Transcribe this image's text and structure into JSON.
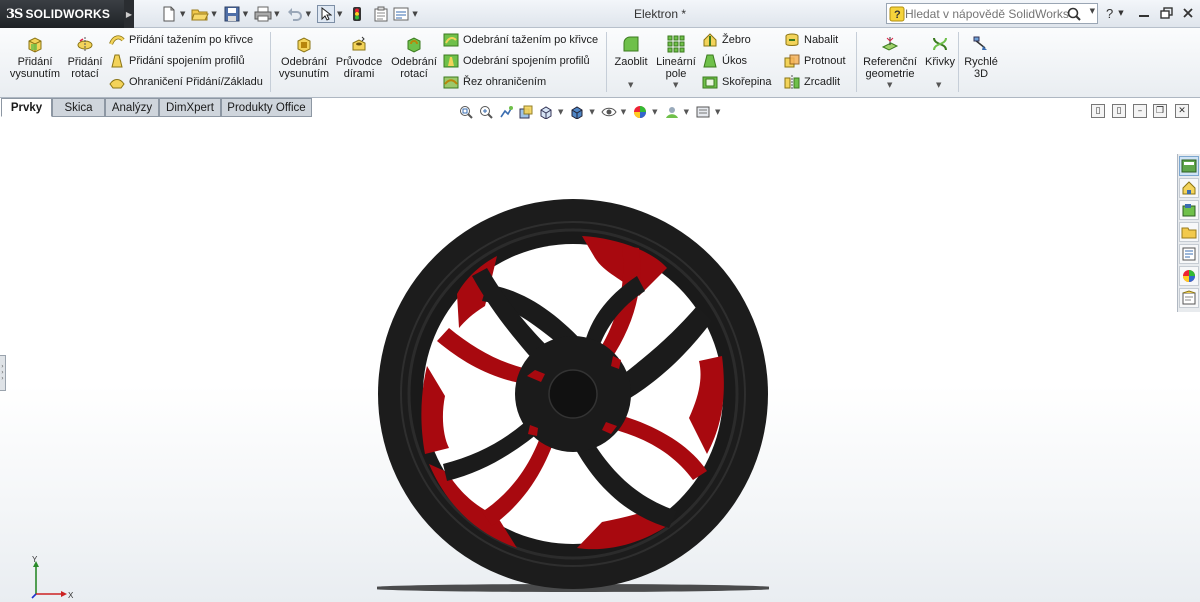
{
  "app": {
    "logo_ds": "3S",
    "logo_text": "SOLIDWORKS"
  },
  "title_bar": {
    "document_title": "Elektron *",
    "search_placeholder": "Hledat v nápovědě SolidWorks"
  },
  "quick_access": [
    "new-icon",
    "open-icon",
    "save-icon",
    "print-icon",
    "undo-icon",
    "select-icon",
    "rebuild-icon",
    "file-properties-icon",
    "options-icon"
  ],
  "ribbon": {
    "extrude_boss": "Přidání\nvysunutím",
    "revolve_boss": "Přidání\nrotací",
    "swept_boss": "Přidání tažením po křivce",
    "lofted_boss": "Přidání spojením profilů",
    "boundary_boss": "Ohraničení Přidání/Základu",
    "extrude_cut": "Odebrání\nvysunutím",
    "hole_wizard": "Průvodce\ndírami",
    "revolve_cut": "Odebrání\nrotací",
    "swept_cut": "Odebrání tažením po křivce",
    "lofted_cut": "Odebrání spojením profilů",
    "boundary_cut": "Řez ohraničením",
    "fillet": "Zaoblit",
    "linear_pattern": "Lineární\npole",
    "rib": "Žebro",
    "draft": "Úkos",
    "shell": "Skořepina",
    "wrap": "Nabalit",
    "intersect": "Protnout",
    "mirror": "Zrcadlit",
    "reference_geometry": "Referenční\ngeometrie",
    "curves": "Křivky",
    "instant3d": "Rychlé\n3D"
  },
  "tabs": [
    "Prvky",
    "Skica",
    "Analýzy",
    "DimXpert",
    "Produkty Office"
  ],
  "active_tab": "Prvky",
  "triad": {
    "x": "X",
    "y": "Y"
  },
  "colors": {
    "wheel_body": "#1c1c1c",
    "wheel_accent": "#a8090f",
    "ribbon_bg": "#eef1f4"
  }
}
